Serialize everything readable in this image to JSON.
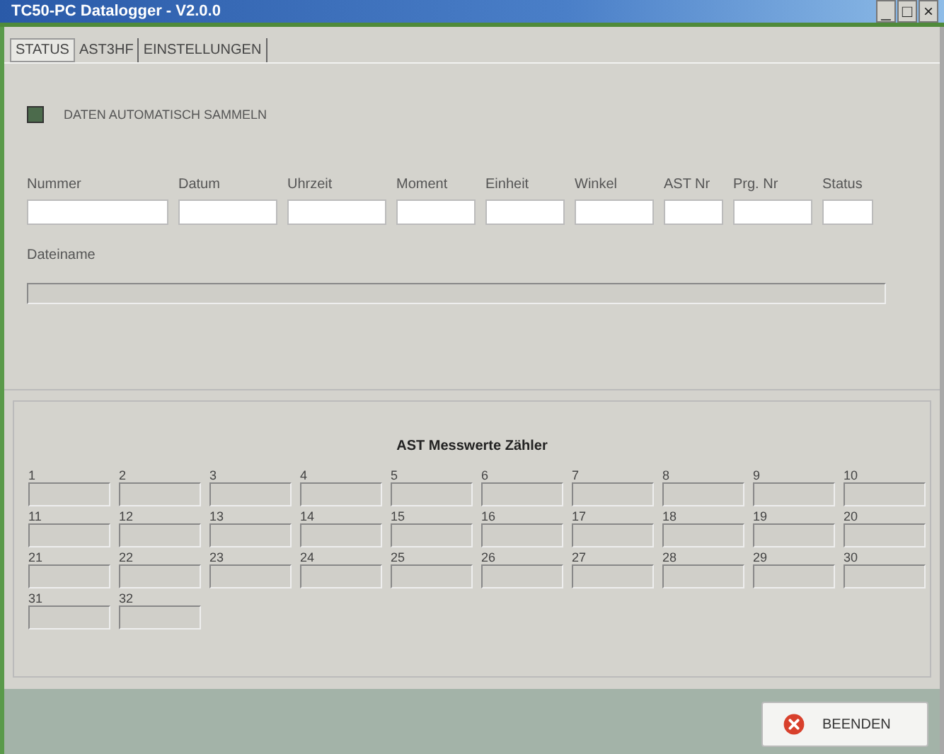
{
  "window": {
    "title": "TC50-PC  Datalogger  -  V2.0.0",
    "controls": [
      "_",
      "□",
      "×"
    ]
  },
  "tabs": [
    {
      "label": "STATUS",
      "selected": true
    },
    {
      "label": "AST3HF",
      "selected": false
    },
    {
      "label": "EINSTELLUNGEN",
      "selected": false
    }
  ],
  "auto_collect": {
    "label": "DATEN AUTOMATISCH SAMMELN",
    "checked": true
  },
  "fields": [
    {
      "label": "Nummer"
    },
    {
      "label": "Datum"
    },
    {
      "label": "Uhrzeit"
    },
    {
      "label": "Moment"
    },
    {
      "label": "Einheit"
    },
    {
      "label": "Winkel"
    },
    {
      "label": "AST Nr"
    },
    {
      "label": "Prg. Nr"
    },
    {
      "label": "Status"
    }
  ],
  "filename": {
    "label": "Dateiname"
  },
  "counters": {
    "title": "AST Messwerte Zähler",
    "items": [
      "1",
      "2",
      "3",
      "4",
      "5",
      "6",
      "7",
      "8",
      "9",
      "10",
      "11",
      "12",
      "13",
      "14",
      "15",
      "16",
      "17",
      "18",
      "19",
      "20",
      "21",
      "22",
      "23",
      "24",
      "25",
      "26",
      "27",
      "28",
      "29",
      "30",
      "31",
      "32"
    ]
  },
  "buttons": [
    {
      "label": "BEENDEN",
      "kind": "close"
    }
  ]
}
